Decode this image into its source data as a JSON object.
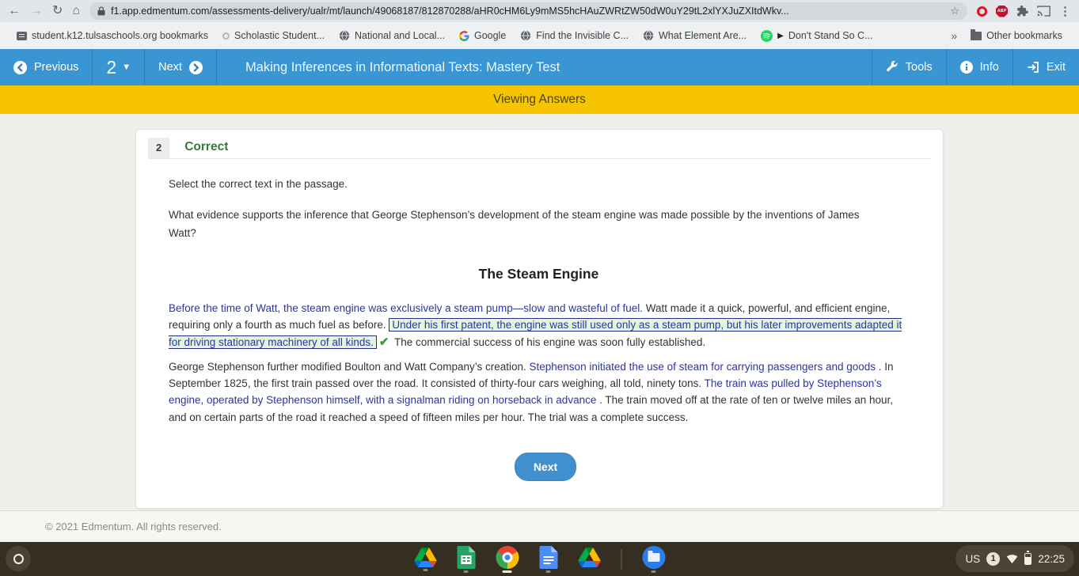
{
  "browser": {
    "url": "f1.app.edmentum.com/assessments-delivery/ualr/mt/launch/49068187/812870288/aHR0cHM6Ly9mMS5hcHAuZWRtZW50dW0uY29tL2xlYXJuZXItdWkv...",
    "bookmarks": [
      {
        "label": "student.k12.tulsaschools.org bookmarks"
      },
      {
        "label": "Scholastic Student..."
      },
      {
        "label": "National and Local..."
      },
      {
        "label": "Google"
      },
      {
        "label": "Find the Invisible C..."
      },
      {
        "label": "What Element Are..."
      },
      {
        "label": "Don't Stand So C..."
      }
    ],
    "overflow_chevron": "»",
    "other_bookmarks_label": "Other bookmarks"
  },
  "assessment_header": {
    "previous_label": "Previous",
    "question_number": "2",
    "next_label": "Next",
    "title": "Making Inferences in Informational Texts: Mastery Test",
    "tools_label": "Tools",
    "info_label": "Info",
    "exit_label": "Exit"
  },
  "banner": {
    "text": "Viewing Answers"
  },
  "question": {
    "number": "2",
    "result": "Correct",
    "instruction": "Select the correct text in the passage.",
    "prompt": "What evidence supports the inference that George Stephenson’s development of the steam engine was made possible by the inventions of James Watt?",
    "next_button_label": "Next",
    "checkmark": "✔"
  },
  "passage": {
    "title": "The Steam Engine",
    "p1": {
      "opt1": "Before the time of Watt, the steam engine was exclusively a steam pump—slow and wasteful of fuel.",
      "plain1": " Watt made it a quick, powerful, and efficient engine, requiring only a fourth as much fuel as before. ",
      "selected": "Under his first patent, the engine was still used only as a steam pump, but his later improvements adapted it for driving stationary machinery of all kinds.",
      "plain2": " The commercial success of his engine was soon fully established."
    },
    "p2": {
      "plain1": "George Stephenson further modified Boulton and Watt Company’s creation. ",
      "opt1": "Stephenson initiated the use of steam for carrying passengers and goods",
      "plain2": " . In September 1825, the first train passed over the road. It consisted of thirty-four cars weighing, all told, ninety tons. ",
      "opt2": "The train was pulled by Stephenson’s engine, operated by Stephenson himself, with a signalman riding on horseback in advance",
      "plain3": " . The train moved off at the rate of ten or twelve miles an hour, and on certain parts of the road it reached a speed of fifteen miles per hour. The trial was a complete success."
    }
  },
  "footer": {
    "copyright": "© 2021 Edmentum. All rights reserved."
  },
  "shelf": {
    "keyboard_layout": "US",
    "notification_count": "1",
    "time": "22:25"
  },
  "colors": {
    "header_blue": "#3996d3",
    "banner_yellow": "#f7c500",
    "correct_green": "#337a3d",
    "option_blue": "#2b35a3",
    "selection_bg": "#e4f5de",
    "selection_border": "#272c83",
    "shelf_brown": "#362e21"
  }
}
